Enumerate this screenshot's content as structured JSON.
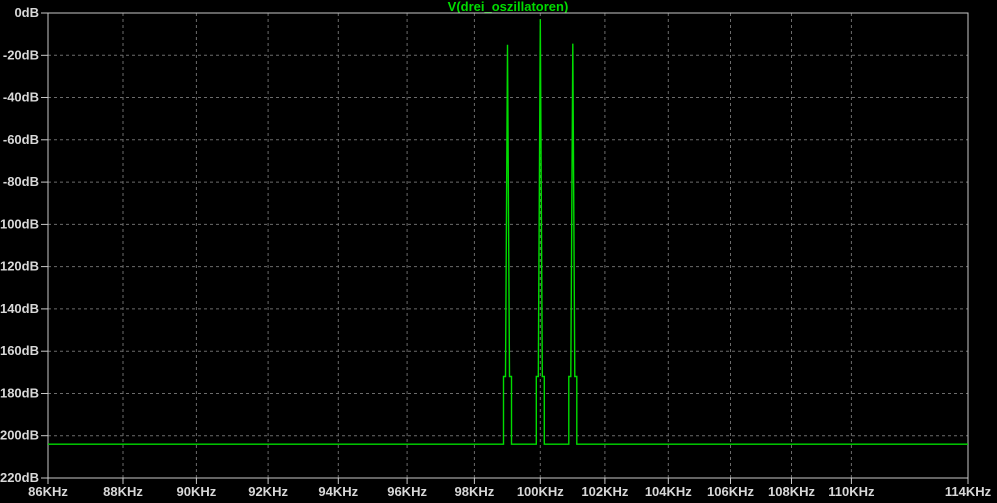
{
  "title": "V(drei_oszillatoren)",
  "colors": {
    "background": "#000000",
    "trace": "#00DC00",
    "title": "#00DC00",
    "grid": "#6C6C6C",
    "border": "#C8C8C8",
    "text": "#D8D8D8"
  },
  "chart_data": {
    "type": "line",
    "title": "V(drei_oszillatoren)",
    "x_scale": "log",
    "x_unit": "KHz",
    "y_unit": "dB",
    "x_range": [
      86,
      114
    ],
    "y_range": [
      -220,
      0
    ],
    "grid": "dashed",
    "legend_position": "none",
    "x_ticks": [
      {
        "value": 86,
        "label": "86KHz"
      },
      {
        "value": 88,
        "label": "88KHz"
      },
      {
        "value": 90,
        "label": "90KHz"
      },
      {
        "value": 92,
        "label": "92KHz"
      },
      {
        "value": 94,
        "label": "94KHz"
      },
      {
        "value": 96,
        "label": "96KHz"
      },
      {
        "value": 98,
        "label": "98KHz"
      },
      {
        "value": 100,
        "label": "100KHz"
      },
      {
        "value": 102,
        "label": "102KHz"
      },
      {
        "value": 104,
        "label": "104KHz"
      },
      {
        "value": 106,
        "label": "106KHz"
      },
      {
        "value": 108,
        "label": "108KHz"
      },
      {
        "value": 110,
        "label": "110KHz"
      },
      {
        "value": 114,
        "label": "114KHz"
      }
    ],
    "y_ticks": [
      {
        "value": 0,
        "label": "0dB"
      },
      {
        "value": -20,
        "label": "-20dB"
      },
      {
        "value": -40,
        "label": "-40dB"
      },
      {
        "value": -60,
        "label": "-60dB"
      },
      {
        "value": -80,
        "label": "-80dB"
      },
      {
        "value": -100,
        "label": "-100dB"
      },
      {
        "value": -120,
        "label": "-120dB"
      },
      {
        "value": -140,
        "label": "-140dB"
      },
      {
        "value": -160,
        "label": "-160dB"
      },
      {
        "value": -180,
        "label": "-180dB"
      },
      {
        "value": -200,
        "label": "-200dB"
      },
      {
        "value": -220,
        "label": "-220dB"
      }
    ],
    "noise_floor_db": -204,
    "peak_shoulder_db": -172,
    "peaks": [
      {
        "freq_khz": 99,
        "db": -15
      },
      {
        "freq_khz": 100,
        "db": -3
      },
      {
        "freq_khz": 101,
        "db": -14.5
      }
    ]
  }
}
